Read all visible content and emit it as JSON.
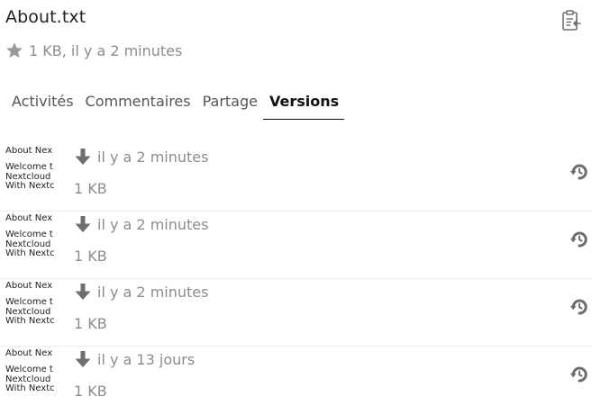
{
  "file": {
    "name": "About.txt",
    "meta": "1 KB, il y a 2 minutes"
  },
  "icons": {
    "clipboard": "clipboard-icon",
    "favorite": "star-icon",
    "download": "download-arrow-icon",
    "restore": "restore-history-icon"
  },
  "tabs": [
    {
      "label": "Activités",
      "active": false
    },
    {
      "label": "Commentaires",
      "active": false
    },
    {
      "label": "Partage",
      "active": false
    },
    {
      "label": "Versions",
      "active": true
    }
  ],
  "versions": [
    {
      "thumb_title": "About Nex",
      "thumb_lines": [
        "Welcome t",
        "Nextcloud",
        "With Nextc"
      ],
      "time": "il y a 2 minutes",
      "size": "1 KB"
    },
    {
      "thumb_title": "About Nex",
      "thumb_lines": [
        "Welcome t",
        "Nextcloud",
        "With Nextc"
      ],
      "time": "il y a 2 minutes",
      "size": "1 KB"
    },
    {
      "thumb_title": "About Nex",
      "thumb_lines": [
        "Welcome t",
        "Nextcloud",
        "With Nextc"
      ],
      "time": "il y a 2 minutes",
      "size": "1 KB"
    },
    {
      "thumb_title": "About Nex",
      "thumb_lines": [
        "Welcome t",
        "Nextcloud",
        "With Nextc"
      ],
      "time": "il y a 13 jours",
      "size": "1 KB"
    }
  ],
  "colors": {
    "text": "#222222",
    "muted": "#8c8c8c",
    "icon": "#6e6e6e",
    "divider": "#ececec"
  }
}
